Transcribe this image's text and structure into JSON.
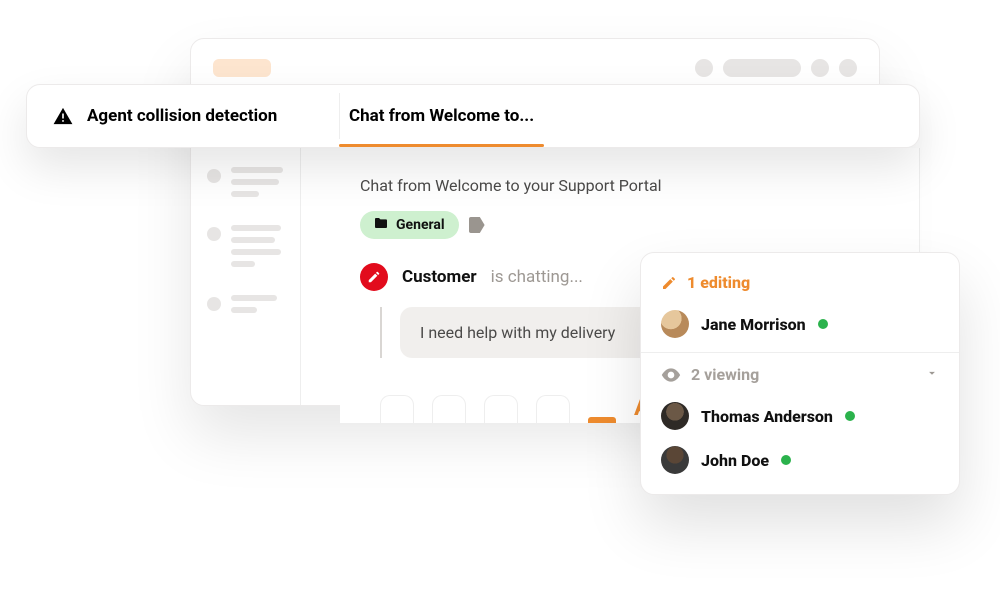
{
  "banner": {
    "alert_label": "Agent collision detection",
    "active_tab_label": "Chat from Welcome to..."
  },
  "ticket": {
    "subject": "Chat from Welcome to your Support Portal",
    "tag_label": "General",
    "customer_label": "Customer",
    "customer_status": "is chatting...",
    "message": "I need help with my delivery"
  },
  "presence": {
    "editing_label": "1 editing",
    "viewing_label": "2 viewing",
    "editing": [
      {
        "name": "Jane Morrison",
        "status_color": "#2bb24c"
      }
    ],
    "viewing": [
      {
        "name": "Thomas Anderson",
        "status_color": "#2bb24c"
      },
      {
        "name": "John Doe",
        "status_color": "#2bb24c"
      }
    ]
  },
  "colors": {
    "accent": "#ee8b2e",
    "danger": "#e20b1c",
    "tag_bg": "#cef0cf",
    "online": "#2bb24c"
  },
  "bottom_tab_glyph": "A"
}
